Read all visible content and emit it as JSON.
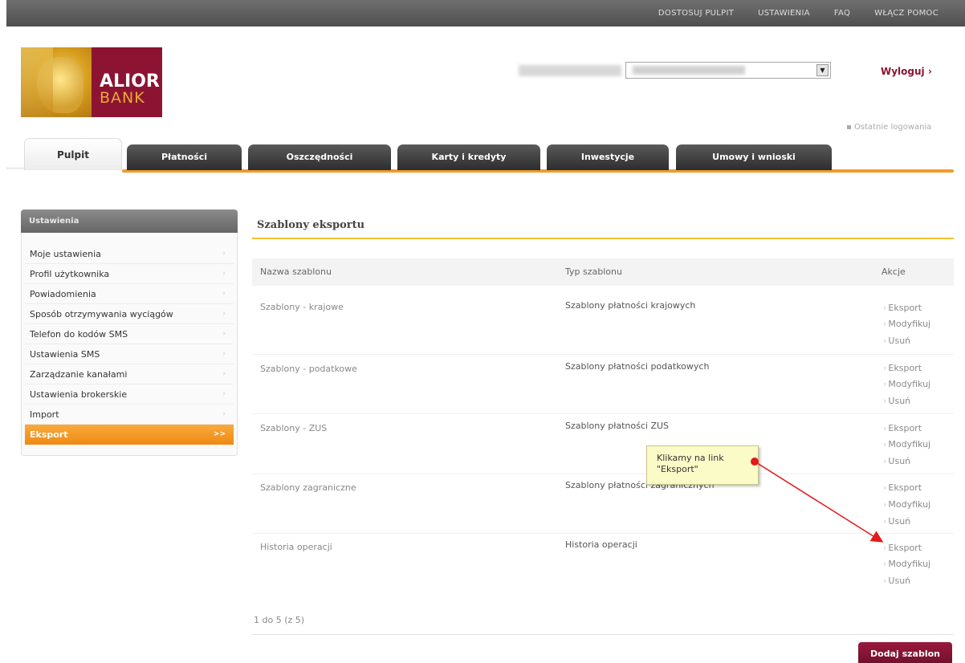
{
  "top_nav": [
    "DOSTOSUJ PULPIT",
    "USTAWIENIA",
    "FAQ",
    "WŁĄCZ POMOC"
  ],
  "logo": {
    "line1": "ALIOR",
    "line2": "BANK"
  },
  "user": {
    "logout": "Wyloguj ›",
    "last_login": "Ostatnie logowania"
  },
  "tabs": [
    "Pulpit",
    "Płatności",
    "Oszczędności",
    "Karty i kredyty",
    "Inwestycje",
    "Umowy i wnioski"
  ],
  "sidebar": {
    "title": "Ustawienia",
    "items": [
      "Moje ustawienia",
      "Profil użytkownika",
      "Powiadomienia",
      "Sposób otrzymywania wyciągów",
      "Telefon do kodów SMS",
      "Ustawienia SMS",
      "Zarządzanie kanałami",
      "Ustawienia brokerskie",
      "Import",
      "Eksport"
    ],
    "chev": "›",
    "active_chev": ">>"
  },
  "main": {
    "title": "Szablony eksportu",
    "columns": [
      "Nazwa szablonu",
      "Typ szablonu",
      "Akcje"
    ],
    "rows": [
      {
        "name": "Szablony - krajowe",
        "type": "Szablony płatności krajowych"
      },
      {
        "name": "Szablony - podatkowe",
        "type": "Szablony płatności podatkowych"
      },
      {
        "name": "Szablony - ZUS",
        "type": "Szablony płatności ZUS"
      },
      {
        "name": "Szablony zagraniczne",
        "type": "Szablony płatności zagranicznych"
      },
      {
        "name": "Historia operacji",
        "type": "Historia operacji"
      }
    ],
    "actions": [
      "Eksport",
      "Modyfikuj",
      "Usuń"
    ],
    "pager": "1 do 5 (z 5)",
    "add_button": "Dodaj szablon"
  },
  "callout": {
    "line1": "Klikamy na link",
    "line2": "\"Eksport\""
  },
  "colors": {
    "brand": "#8c1432",
    "accent": "#f39a2b",
    "annotation": "#e11a1a"
  }
}
